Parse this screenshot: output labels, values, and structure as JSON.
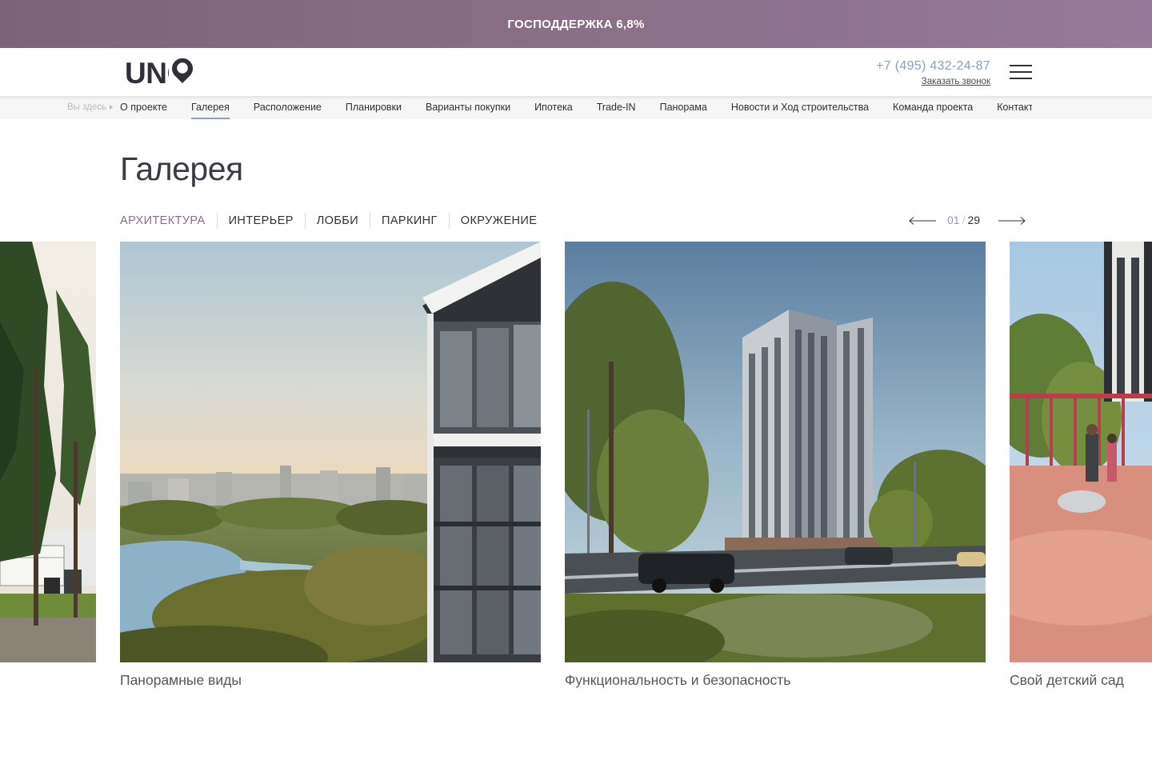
{
  "promo": {
    "text": "ГОСПОДДЕРЖКА 6,8%"
  },
  "header": {
    "logo_text": "UNO",
    "phone": "+7 (495) 432-24-87",
    "callback": "Заказать звонок",
    "menu_icon": "hamburger-icon"
  },
  "breadcrumb": {
    "label": "Вы здесь"
  },
  "nav": {
    "items": [
      {
        "label": "О проекте"
      },
      {
        "label": "Галерея",
        "active": true
      },
      {
        "label": "Расположение"
      },
      {
        "label": "Планировки"
      },
      {
        "label": "Варианты покупки"
      },
      {
        "label": "Ипотека"
      },
      {
        "label": "Trade-IN"
      },
      {
        "label": "Панорама"
      },
      {
        "label": "Новости и Ход строительства"
      },
      {
        "label": "Команда проекта"
      },
      {
        "label": "Контакты"
      }
    ]
  },
  "page": {
    "title": "Галерея"
  },
  "tabs": [
    {
      "label": "АРХИТЕКТУРА",
      "active": true
    },
    {
      "label": "ИНТЕРЬЕР"
    },
    {
      "label": "ЛОББИ"
    },
    {
      "label": "ПАРКИНГ"
    },
    {
      "label": "ОКРУЖЕНИЕ"
    }
  ],
  "counter": {
    "current": "01",
    "total": "29",
    "prev_icon": "arrow-left-icon",
    "next_icon": "arrow-right-icon"
  },
  "slides": [
    {
      "caption": "",
      "image": "park-trees-photo"
    },
    {
      "caption": "Панорамные виды",
      "image": "river-panorama-view"
    },
    {
      "caption": "Функциональность и безопасность",
      "image": "residential-tower-street"
    },
    {
      "caption": "Свой детский сад",
      "image": "kindergarten-playground"
    }
  ],
  "colors": {
    "accent": "#8e6b89",
    "link": "#8aa0bd",
    "promo_bg": "#8a6f86",
    "text": "#2f3038"
  }
}
